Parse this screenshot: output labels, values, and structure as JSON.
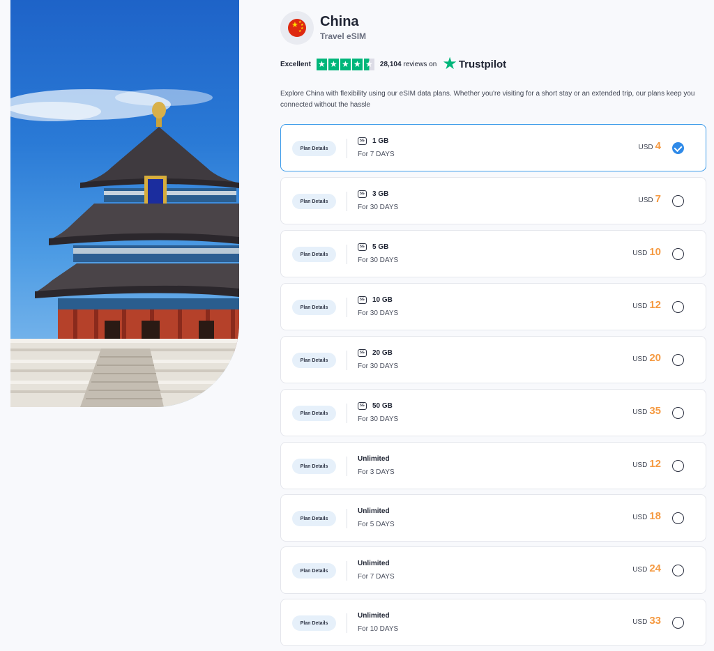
{
  "header": {
    "flag_icon": "china-flag-icon",
    "title": "China",
    "subtitle": "Travel eSIM"
  },
  "rating": {
    "label": "Excellent",
    "stars": 4.5,
    "review_count": "28,104",
    "review_suffix": "reviews on",
    "brand": "Trustpilot",
    "brand_color": "#00b67a"
  },
  "description": "Explore China with flexibility using our eSIM data plans. Whether you're visiting for a short stay or an extended trip, our plans keep you connected without the hassle",
  "colors": {
    "price_accent": "#f59a42",
    "selected_border": "#3d9be9",
    "check_fill": "#2f8ae8",
    "pill_bg": "#e6f0fa"
  },
  "plans": [
    {
      "details_label": "Plan Details",
      "network_badge": "5G",
      "data": "1 GB",
      "duration": "For 7 DAYS",
      "currency": "USD",
      "price": "4",
      "selected": true
    },
    {
      "details_label": "Plan Details",
      "network_badge": "5G",
      "data": "3 GB",
      "duration": "For 30 DAYS",
      "currency": "USD",
      "price": "7",
      "selected": false
    },
    {
      "details_label": "Plan Details",
      "network_badge": "5G",
      "data": "5 GB",
      "duration": "For 30 DAYS",
      "currency": "USD",
      "price": "10",
      "selected": false
    },
    {
      "details_label": "Plan Details",
      "network_badge": "5G",
      "data": "10 GB",
      "duration": "For 30 DAYS",
      "currency": "USD",
      "price": "12",
      "selected": false
    },
    {
      "details_label": "Plan Details",
      "network_badge": "5G",
      "data": "20 GB",
      "duration": "For 30 DAYS",
      "currency": "USD",
      "price": "20",
      "selected": false
    },
    {
      "details_label": "Plan Details",
      "network_badge": "5G",
      "data": "50 GB",
      "duration": "For 30 DAYS",
      "currency": "USD",
      "price": "35",
      "selected": false
    },
    {
      "details_label": "Plan Details",
      "network_badge": "",
      "data": "Unlimited",
      "duration": "For 3 DAYS",
      "currency": "USD",
      "price": "12",
      "selected": false
    },
    {
      "details_label": "Plan Details",
      "network_badge": "",
      "data": "Unlimited",
      "duration": "For 5 DAYS",
      "currency": "USD",
      "price": "18",
      "selected": false
    },
    {
      "details_label": "Plan Details",
      "network_badge": "",
      "data": "Unlimited",
      "duration": "For 7 DAYS",
      "currency": "USD",
      "price": "24",
      "selected": false
    },
    {
      "details_label": "Plan Details",
      "network_badge": "",
      "data": "Unlimited",
      "duration": "For 10 DAYS",
      "currency": "USD",
      "price": "33",
      "selected": false
    }
  ]
}
